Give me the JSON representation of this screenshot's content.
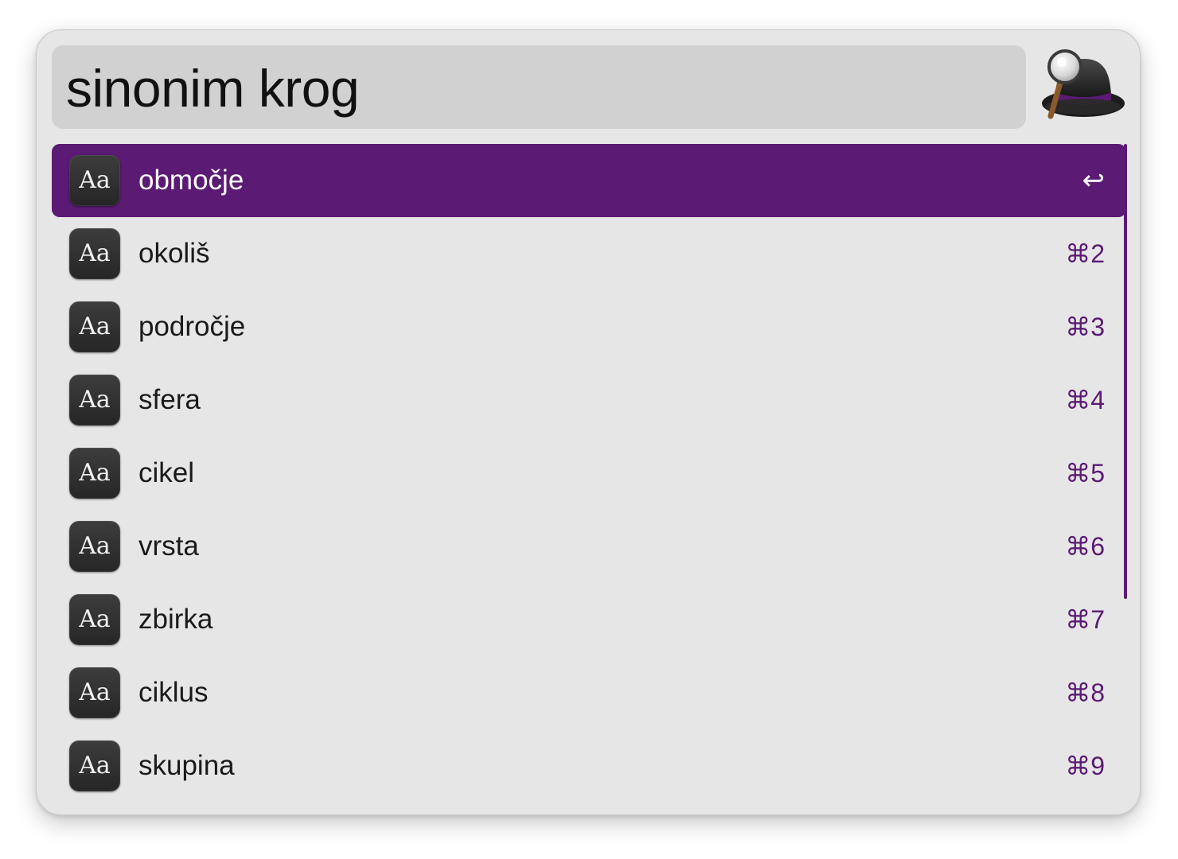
{
  "search": {
    "query": "sinonim krog"
  },
  "app": {
    "logo_icon": "alfred-hat-magnifier-icon",
    "accent_color": "#5b1a73"
  },
  "results": [
    {
      "icon_label": "Aa",
      "title": "območje",
      "shortcut": "↩",
      "selected": true
    },
    {
      "icon_label": "Aa",
      "title": "okoliš",
      "shortcut": "⌘2",
      "selected": false
    },
    {
      "icon_label": "Aa",
      "title": "področje",
      "shortcut": "⌘3",
      "selected": false
    },
    {
      "icon_label": "Aa",
      "title": "sfera",
      "shortcut": "⌘4",
      "selected": false
    },
    {
      "icon_label": "Aa",
      "title": "cikel",
      "shortcut": "⌘5",
      "selected": false
    },
    {
      "icon_label": "Aa",
      "title": "vrsta",
      "shortcut": "⌘6",
      "selected": false
    },
    {
      "icon_label": "Aa",
      "title": "zbirka",
      "shortcut": "⌘7",
      "selected": false
    },
    {
      "icon_label": "Aa",
      "title": "ciklus",
      "shortcut": "⌘8",
      "selected": false
    },
    {
      "icon_label": "Aa",
      "title": "skupina",
      "shortcut": "⌘9",
      "selected": false
    }
  ]
}
